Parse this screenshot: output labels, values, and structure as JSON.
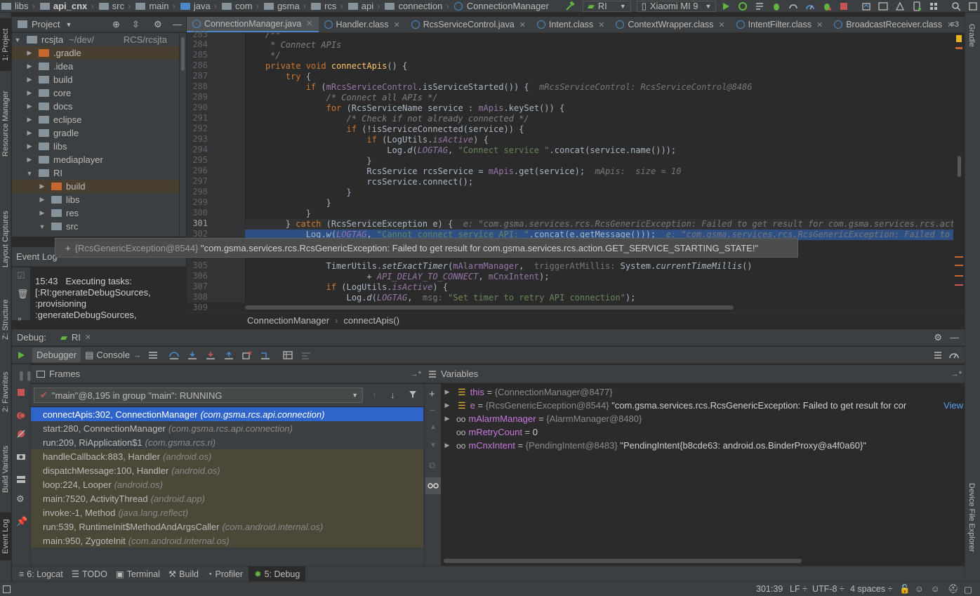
{
  "nav": {
    "crumbs": [
      "libs",
      "api_cnx",
      "src",
      "main",
      "java",
      "com",
      "gsma",
      "rcs",
      "api",
      "connection",
      "ConnectionManager"
    ],
    "run_config": "RI",
    "device": "Xiaomi MI 9"
  },
  "left_strip": {
    "project": "1: Project",
    "resource_manager": "Resource Manager",
    "layout_captures": "Layout Captures",
    "structure": "Z: Structure",
    "favorites": "2: Favorites",
    "build_variants": "Build Variants",
    "event_log": "Event Log"
  },
  "right_strip": {
    "gradle": "Gradle",
    "device_file_explorer": "Device File Explorer"
  },
  "project": {
    "header": "Project",
    "root_name": "rcsjta",
    "root_path": "~/dev/",
    "root_path2": "RCS/rcsjta",
    "items": [
      {
        "label": ".gradle"
      },
      {
        "label": ".idea"
      },
      {
        "label": "build"
      },
      {
        "label": "core"
      },
      {
        "label": "docs"
      },
      {
        "label": "eclipse"
      },
      {
        "label": "gradle"
      },
      {
        "label": "libs"
      },
      {
        "label": "mediaplayer"
      },
      {
        "label": "RI"
      },
      {
        "label": "build"
      },
      {
        "label": "libs"
      },
      {
        "label": "res"
      },
      {
        "label": "src"
      }
    ]
  },
  "event_log": {
    "title": "Event Log",
    "time": "15:43",
    "message": "Executing tasks:",
    "line2": "[:RI:generateDebugSources,",
    "line3": ":provisioning",
    "line4": ":generateDebugSources,"
  },
  "tabs": [
    {
      "label": "ConnectionManager.java"
    },
    {
      "label": "Handler.class"
    },
    {
      "label": "RcsServiceControl.java"
    },
    {
      "label": "Intent.class"
    },
    {
      "label": "ContextWrapper.class"
    },
    {
      "label": "IntentFilter.class"
    },
    {
      "label": "BroadcastReceiver.class"
    }
  ],
  "tabs_more": "≡3",
  "editor": {
    "line_numbers": [
      "283",
      "284",
      "285",
      "286",
      "287",
      "288",
      "289",
      "290",
      "291",
      "292",
      "293",
      "294",
      "295",
      "296",
      "297",
      "298",
      "299",
      "300",
      "301",
      "302",
      "",
      "",
      "305",
      "306",
      "307",
      "308",
      "309"
    ]
  },
  "tooltip": {
    "type": "{RcsGenericException@8544}",
    "value": "\"com.gsma.services.rcs.RcsGenericException: Failed to get result for com.gsma.services.rcs.action.GET_SERVICE_STARTING_STATE!\""
  },
  "breadcrumb": {
    "class": "ConnectionManager",
    "method": "connectApis()"
  },
  "debug": {
    "title": "Debug:",
    "config": "RI",
    "debugger_tab": "Debugger",
    "console_tab": "Console",
    "frames_label": "Frames",
    "variables_label": "Variables",
    "thread": "\"main\"@8,195 in group \"main\": RUNNING",
    "frames": [
      {
        "method": "connectApis:302, ConnectionManager",
        "pkg": "(com.gsma.rcs.api.connection)"
      },
      {
        "method": "start:280, ConnectionManager",
        "pkg": "(com.gsma.rcs.api.connection)"
      },
      {
        "method": "run:209, RiApplication$1",
        "pkg": "(com.gsma.rcs.ri)"
      },
      {
        "method": "handleCallback:883, Handler",
        "pkg": "(android.os)"
      },
      {
        "method": "dispatchMessage:100, Handler",
        "pkg": "(android.os)"
      },
      {
        "method": "loop:224, Looper",
        "pkg": "(android.os)"
      },
      {
        "method": "main:7520, ActivityThread",
        "pkg": "(android.app)"
      },
      {
        "method": "invoke:-1, Method",
        "pkg": "(java.lang.reflect)"
      },
      {
        "method": "run:539, RuntimeInit$MethodAndArgsCaller",
        "pkg": "(com.android.internal.os)"
      },
      {
        "method": "main:950, ZygoteInit",
        "pkg": "(com.android.internal.os)"
      }
    ],
    "variables": [
      {
        "name": "this",
        "type": "{ConnectionManager@8477}",
        "value": ""
      },
      {
        "name": "e",
        "type": "{RcsGenericException@8544}",
        "value": "\"com.gsma.services.rcs.RcsGenericException: Failed to get result for cor",
        "link": "View"
      },
      {
        "name": "mAlarmManager",
        "type": "{AlarmManager@8480}",
        "value": ""
      },
      {
        "name": "mRetryCount",
        "type": "",
        "value": "0"
      },
      {
        "name": "mCnxIntent",
        "type": "{PendingIntent@8483}",
        "value": "\"PendingIntent{b8cde63: android.os.BinderProxy@a4f0a60}\""
      }
    ]
  },
  "bottom_tools": [
    {
      "label": "6: Logcat"
    },
    {
      "label": "TODO"
    },
    {
      "label": "Terminal"
    },
    {
      "label": "Build"
    },
    {
      "label": "Profiler"
    },
    {
      "label": "5: Debug"
    }
  ],
  "status": {
    "position": "301:39",
    "line_sep": "LF ÷",
    "encoding": "UTF-8 ÷",
    "indent": "4 spaces ÷"
  }
}
